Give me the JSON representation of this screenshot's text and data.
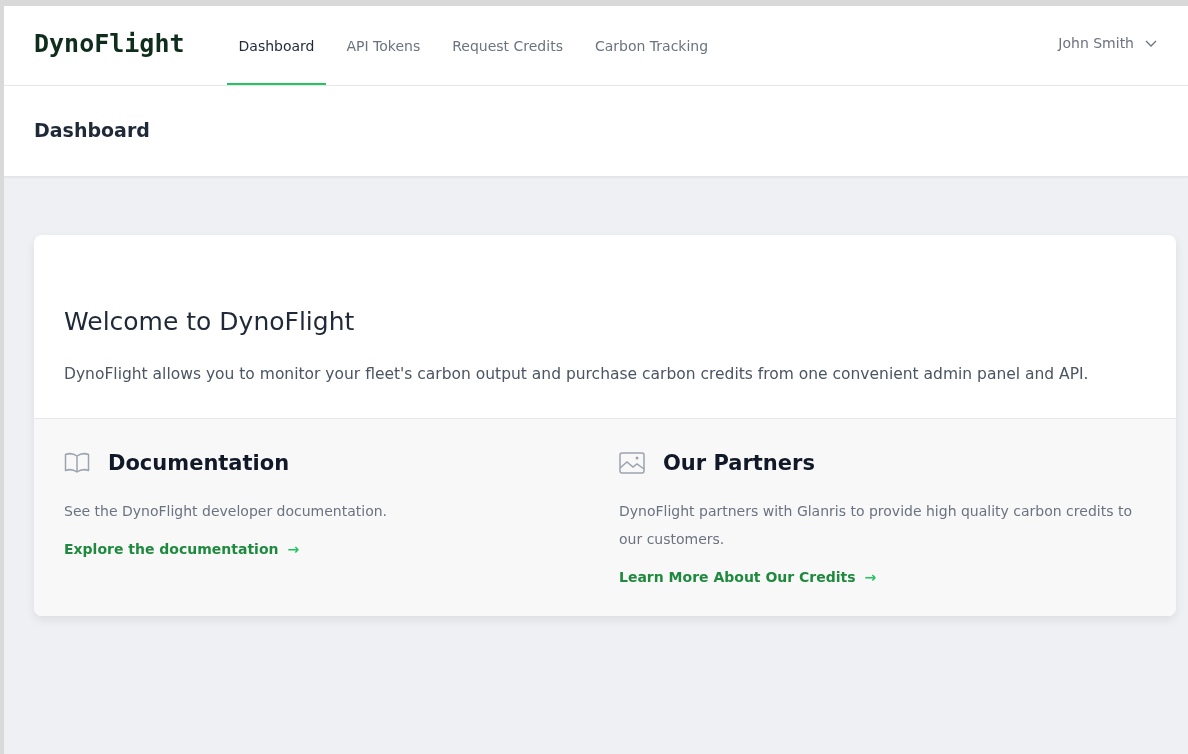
{
  "brand": "DynoFlight",
  "nav": [
    {
      "label": "Dashboard",
      "selected": true
    },
    {
      "label": "API Tokens",
      "selected": false
    },
    {
      "label": "Request Credits",
      "selected": false
    },
    {
      "label": "Carbon Tracking",
      "selected": false
    }
  ],
  "user_menu": {
    "label": "John Smith"
  },
  "page_title": "Dashboard",
  "welcome": {
    "title": "Welcome to DynoFlight",
    "text": "DynoFlight allows you to monitor your fleet's carbon output and purchase carbon credits from one convenient admin panel and API."
  },
  "sections": [
    {
      "kind": "book",
      "title": "Documentation",
      "text": "See the DynoFlight developer documentation.",
      "link": "Explore the documentation",
      "arrow": "→"
    },
    {
      "kind": "image",
      "title": "Our Partners",
      "text": "DynoFlight partners with Glanris to provide high quality carbon credits to our customers.",
      "link": "Learn More About Our Credits",
      "arrow": "→"
    }
  ]
}
